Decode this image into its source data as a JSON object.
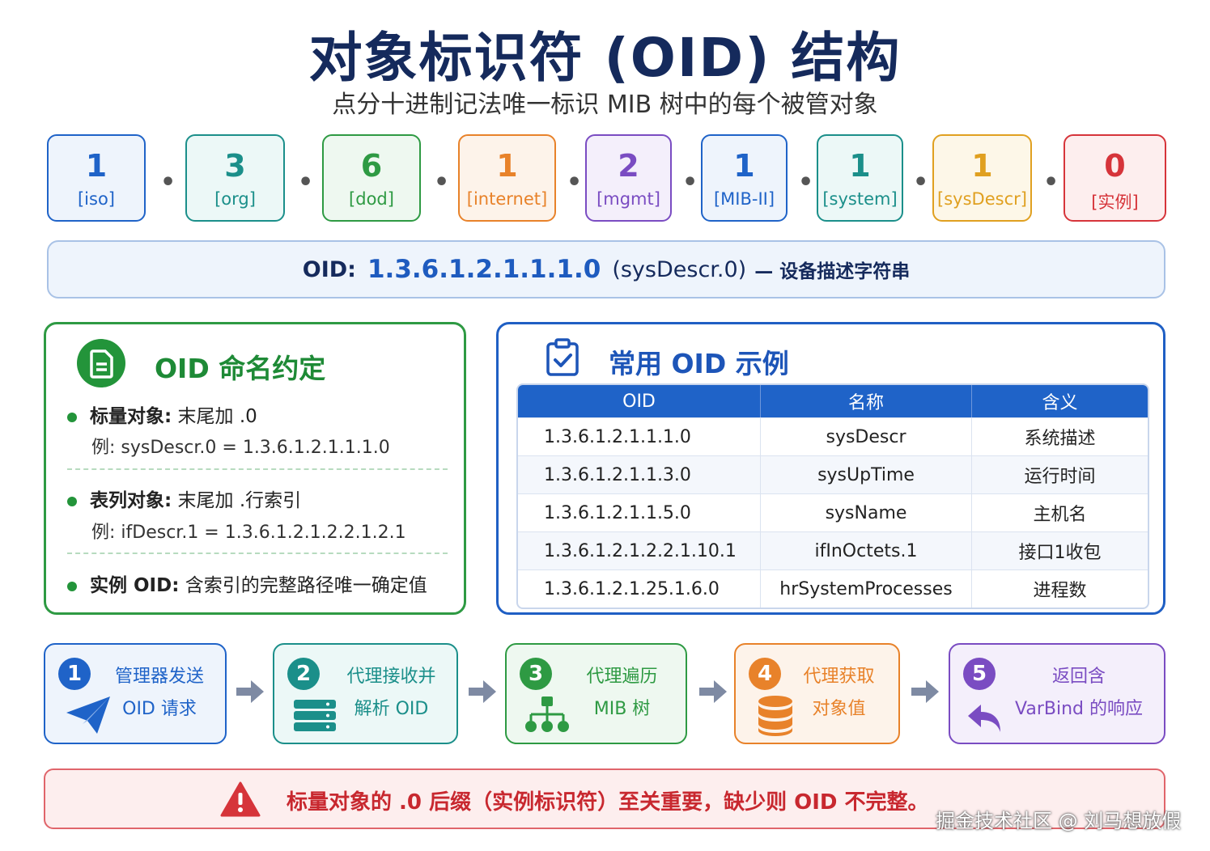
{
  "title": "对象标识符 (OID) 结构",
  "subtitle": "点分十进制记法唯一标识 MIB 树中的每个被管对象",
  "nodes": [
    {
      "num": "1",
      "label": "[iso]",
      "color": "#1f63c8",
      "bg": "#eef4fc"
    },
    {
      "num": "3",
      "label": "[org]",
      "color": "#1b8f8a",
      "bg": "#ecf8f7"
    },
    {
      "num": "6",
      "label": "[dod]",
      "color": "#2e9a43",
      "bg": "#eef8f0"
    },
    {
      "num": "1",
      "label": "[internet]",
      "color": "#e8822a",
      "bg": "#fdf3ea"
    },
    {
      "num": "2",
      "label": "[mgmt]",
      "color": "#7a4cc2",
      "bg": "#f4effb"
    },
    {
      "num": "1",
      "label": "[MIB-II]",
      "color": "#1f63c8",
      "bg": "#eef4fc"
    },
    {
      "num": "1",
      "label": "[system]",
      "color": "#1b8f8a",
      "bg": "#ecf8f7"
    },
    {
      "num": "1",
      "label": "[sysDescr]",
      "color": "#e0a020",
      "bg": "#fdf7e8"
    },
    {
      "num": "0",
      "label": "[实例]",
      "color": "#d6343a",
      "bg": "#fdeeee"
    }
  ],
  "dot": "•",
  "oid_bar": {
    "key": "OID:",
    "value": "1.3.6.1.2.1.1.1.0",
    "name": "(sysDescr.0)",
    "desc": "— 设备描述字符串"
  },
  "naming": {
    "title": "OID 命名约定",
    "items": [
      {
        "head": "标量对象:",
        "text": " 末尾加 .0",
        "example": "例:  sysDescr.0 = 1.3.6.1.2.1.1.1.0"
      },
      {
        "head": "表列对象:",
        "text": " 末尾加 .行索引",
        "example": "例:  ifDescr.1 = 1.3.6.1.2.1.2.2.1.2.1"
      },
      {
        "head": "实例 OID:",
        "text": " 含索引的完整路径唯一确定值",
        "example": ""
      }
    ]
  },
  "examples": {
    "title": "常用 OID 示例",
    "headers": [
      "OID",
      "名称",
      "含义"
    ],
    "rows": [
      [
        "1.3.6.1.2.1.1.1.0",
        "sysDescr",
        "系统描述"
      ],
      [
        "1.3.6.1.2.1.1.3.0",
        "sysUpTime",
        "运行时间"
      ],
      [
        "1.3.6.1.2.1.1.5.0",
        "sysName",
        "主机名"
      ],
      [
        "1.3.6.1.2.1.2.2.1.10.1",
        "ifInOctets.1",
        "接口1收包"
      ],
      [
        "1.3.6.1.2.1.25.1.6.0",
        "hrSystemProcesses",
        "进程数"
      ]
    ]
  },
  "steps": [
    {
      "num": "1",
      "line1": "管理器发送",
      "line2": "OID 请求",
      "icon": "send-icon",
      "color": "#1f63c8",
      "bg": "#eef4fc"
    },
    {
      "num": "2",
      "line1": "代理接收并",
      "line2": "解析 OID",
      "icon": "server-icon",
      "color": "#1b8f8a",
      "bg": "#ecf8f7"
    },
    {
      "num": "3",
      "line1": "代理遍历",
      "line2": "MIB 树",
      "icon": "tree-icon",
      "color": "#2e9a43",
      "bg": "#eef8f0"
    },
    {
      "num": "4",
      "line1": "代理获取",
      "line2": "对象值",
      "icon": "database-icon",
      "color": "#e8822a",
      "bg": "#fdf3ea"
    },
    {
      "num": "5",
      "line1": "返回含",
      "line2": "VarBind 的响应",
      "icon": "reply-icon",
      "color": "#7a4cc2",
      "bg": "#f4effb"
    }
  ],
  "warning": "标量对象的 .0 后缀（实例标识符）至关重要，缺少则 OID 不完整。",
  "watermark": "掘金技术社区 @ 刘马想放假"
}
